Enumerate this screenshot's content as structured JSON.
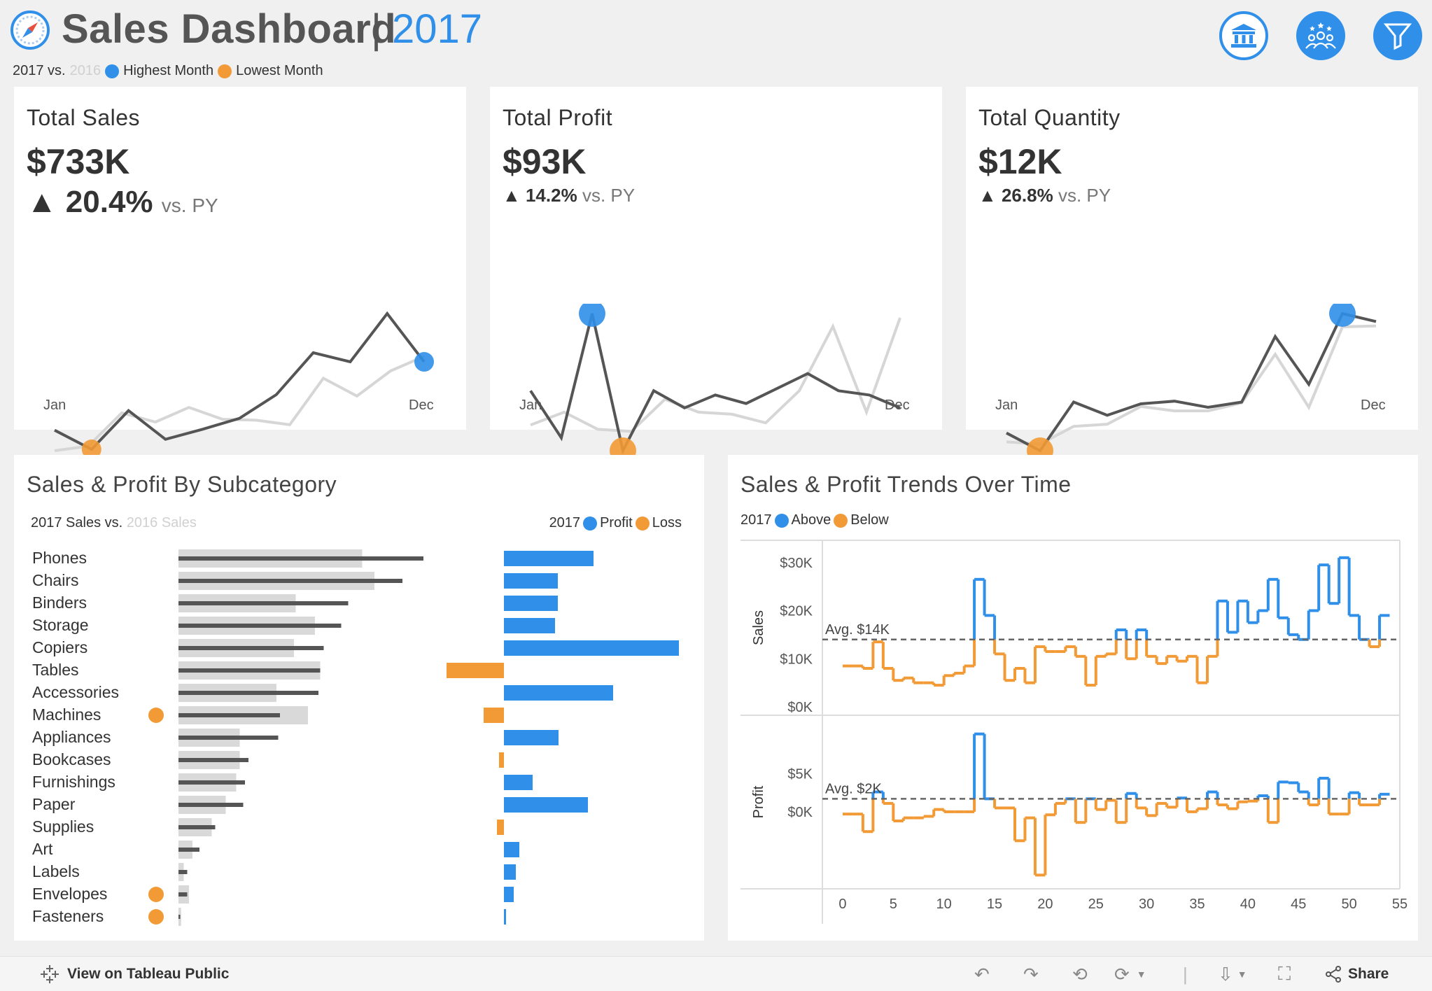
{
  "header": {
    "title": "Sales Dashboard",
    "separator": "|",
    "year": "2017",
    "legend": {
      "current": "2017 vs.",
      "previous": "2016",
      "highest": "Highest Month",
      "lowest": "Lowest Month"
    },
    "icons": [
      "bank-icon",
      "people-icon",
      "filter-icon"
    ]
  },
  "kpis": [
    {
      "title": "Total Sales",
      "value": "$733K",
      "change": "20.4%",
      "vs": "vs. PY",
      "x_start": "Jan",
      "x_end": "Dec",
      "current": [
        100,
        58,
        143,
        80,
        102,
        126,
        178,
        270,
        250,
        356,
        250
      ],
      "previous": [
        55,
        65,
        138,
        118,
        150,
        124,
        122,
        112,
        214,
        175,
        230,
        262
      ],
      "current_full": [
        100,
        58,
        143,
        80,
        102,
        126,
        178,
        270,
        250,
        356,
        250
      ],
      "highest_index": 10,
      "lowest_index": 1
    },
    {
      "title": "Total Profit",
      "value": "$93K",
      "change": "14.2%",
      "vs": "vs. PY",
      "x_start": "Jan",
      "x_end": "Dec",
      "current": [
        150,
        40,
        330,
        10,
        150,
        110,
        140,
        120,
        155,
        190,
        150,
        140,
        110
      ],
      "previous": [
        70,
        100,
        60,
        55,
        130,
        100,
        95,
        75,
        150,
        300,
        100,
        320
      ],
      "highest_index": 2,
      "lowest_index": 3
    },
    {
      "title": "Total Quantity",
      "value": "$12K",
      "change": "26.8%",
      "vs": "vs. PY",
      "x_start": "Jan",
      "x_end": "Dec",
      "current": [
        60,
        20,
        130,
        100,
        126,
        132,
        118,
        130,
        278,
        170,
        330,
        312
      ],
      "previous": [
        40,
        35,
        75,
        80,
        120,
        110,
        110,
        128,
        238,
        118,
        300,
        302
      ],
      "highest_index": 10,
      "lowest_index": 1
    }
  ],
  "subcategory": {
    "title": "Sales & Profit By Subcategory",
    "legend_left": {
      "current": "2017 Sales vs.",
      "previous": "2016 Sales"
    },
    "legend_right": {
      "year": "2017",
      "profit": "Profit",
      "loss": "Loss"
    },
    "rows": [
      {
        "name": "Phones",
        "sales_2016": 105000,
        "sales_2017": 140000,
        "profit": 12800,
        "loss_flag": false
      },
      {
        "name": "Chairs",
        "sales_2016": 112000,
        "sales_2017": 128000,
        "profit": 7700,
        "loss_flag": false
      },
      {
        "name": "Binders",
        "sales_2016": 67000,
        "sales_2017": 97000,
        "profit": 7700,
        "loss_flag": false
      },
      {
        "name": "Storage",
        "sales_2016": 78000,
        "sales_2017": 93000,
        "profit": 7300,
        "loss_flag": false
      },
      {
        "name": "Copiers",
        "sales_2016": 66000,
        "sales_2017": 83000,
        "profit": 25000,
        "loss_flag": false
      },
      {
        "name": "Tables",
        "sales_2016": 81000,
        "sales_2017": 81000,
        "profit": -8200,
        "loss_flag": false
      },
      {
        "name": "Accessories",
        "sales_2016": 56000,
        "sales_2017": 80000,
        "profit": 15600,
        "loss_flag": false
      },
      {
        "name": "Machines",
        "sales_2016": 74000,
        "sales_2017": 58000,
        "profit": -2900,
        "loss_flag": true
      },
      {
        "name": "Appliances",
        "sales_2016": 35000,
        "sales_2017": 57000,
        "profit": 7800,
        "loss_flag": false
      },
      {
        "name": "Bookcases",
        "sales_2016": 35000,
        "sales_2017": 40000,
        "profit": -700,
        "loss_flag": false
      },
      {
        "name": "Furnishings",
        "sales_2016": 33000,
        "sales_2017": 38000,
        "profit": 4100,
        "loss_flag": false
      },
      {
        "name": "Paper",
        "sales_2016": 27000,
        "sales_2017": 37000,
        "profit": 12000,
        "loss_flag": false
      },
      {
        "name": "Supplies",
        "sales_2016": 19000,
        "sales_2017": 21000,
        "profit": -1000,
        "loss_flag": false
      },
      {
        "name": "Art",
        "sales_2016": 8000,
        "sales_2017": 12000,
        "profit": 2200,
        "loss_flag": false
      },
      {
        "name": "Labels",
        "sales_2016": 3000,
        "sales_2017": 5000,
        "profit": 1700,
        "loss_flag": false
      },
      {
        "name": "Envelopes",
        "sales_2016": 6000,
        "sales_2017": 5000,
        "profit": 1400,
        "loss_flag": true
      },
      {
        "name": "Fasteners",
        "sales_2016": 1500,
        "sales_2017": 1000,
        "profit": 300,
        "loss_flag": true
      }
    ],
    "sales_max": 140000,
    "profit_range": [
      -8200,
      25000
    ]
  },
  "trends": {
    "title": "Sales & Profit Trends Over Time",
    "legend": {
      "year": "2017",
      "above": "Above",
      "below": "Below"
    },
    "sales_axis_title": "Sales",
    "profit_axis_title": "Profit",
    "sales_ticks": [
      "$30K",
      "$20K",
      "$10K",
      "$0K"
    ],
    "sales_tick_values": [
      30000,
      20000,
      10000,
      0
    ],
    "profit_ticks": [
      "$5K",
      "$0K"
    ],
    "profit_tick_values": [
      5000,
      0
    ],
    "sales_avg_label": "Avg. $14K",
    "profit_avg_label": "Avg. $2K",
    "sales_avg": 14000,
    "profit_avg": 1700,
    "x_ticks": [
      "0",
      "5",
      "10",
      "15",
      "20",
      "25",
      "30",
      "35",
      "40",
      "45",
      "50",
      "55"
    ],
    "sales_weekly": [
      8500,
      8500,
      8000,
      13500,
      8000,
      5500,
      6000,
      5000,
      5000,
      4500,
      6500,
      7000,
      8500,
      26500,
      19000,
      11000,
      5500,
      8000,
      5000,
      12500,
      11500,
      11500,
      12500,
      10500,
      4500,
      10500,
      11000,
      16000,
      10000,
      16000,
      10500,
      9000,
      10500,
      9500,
      10500,
      5000,
      10500,
      22000,
      15500,
      22000,
      17500,
      20000,
      26500,
      18500,
      15000,
      14000,
      20000,
      29500,
      21500,
      31000,
      19000,
      14000,
      12500,
      19000
    ],
    "profit_weekly": [
      -300,
      -300,
      -2600,
      2600,
      1100,
      -1200,
      -800,
      -800,
      -600,
      300,
      0,
      0,
      0,
      10200,
      1700,
      500,
      500,
      -3800,
      -800,
      -8300,
      -400,
      1100,
      1700,
      -1400,
      1700,
      300,
      1500,
      -1400,
      2400,
      500,
      -500,
      1100,
      600,
      1800,
      0,
      400,
      2600,
      900,
      400,
      1300,
      1400,
      2100,
      -1400,
      3900,
      3800,
      2600,
      900,
      4400,
      -300,
      -300,
      2500,
      900,
      900,
      2300
    ],
    "week_count": 54,
    "x_range": [
      -2,
      55
    ],
    "sales_range": [
      0,
      32000
    ],
    "profit_range": [
      -9000,
      11000
    ]
  },
  "footer": {
    "tableau_link": "View on Tableau Public",
    "share": "Share"
  },
  "colors": {
    "blue": "#2f8fe9",
    "orange": "#f29a35",
    "dark_line": "#555555",
    "light_line": "#d6d6d6",
    "bar_2016": "#d9d9d9",
    "bar_2017": "#555555"
  }
}
